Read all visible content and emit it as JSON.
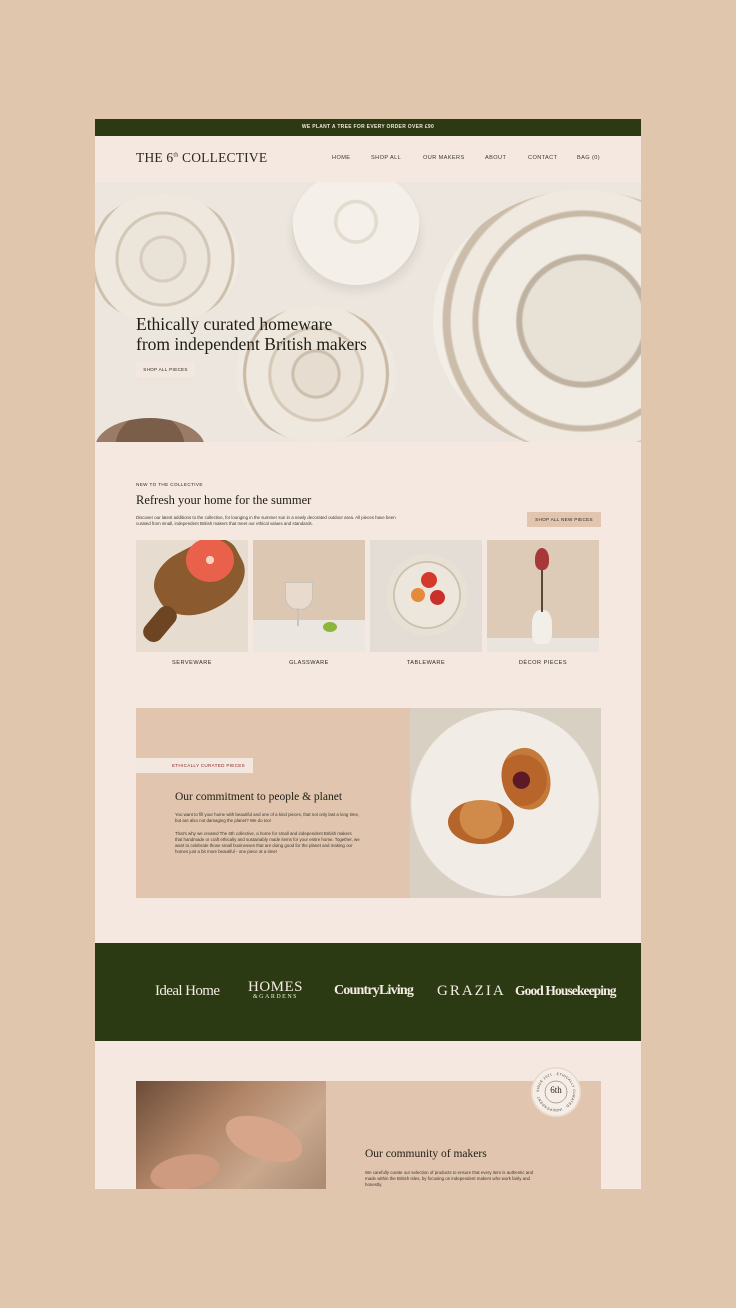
{
  "topbar": {
    "text": "WE PLANT A TREE FOR EVERY ORDER OVER £90"
  },
  "header": {
    "logo_pre": "THE 6",
    "logo_sup": "th",
    "logo_post": " COLLECTIVE",
    "nav": [
      "HOME",
      "SHOP ALL",
      "OUR MAKERS",
      "ABOUT",
      "CONTACT",
      "BAG (0)"
    ]
  },
  "hero": {
    "title_line1": "Ethically curated homeware",
    "title_line2": "from independent British makers",
    "button": "SHOP ALL PIECES"
  },
  "new_section": {
    "eyebrow": "NEW TO THE COLLECTIVE",
    "title": "Refresh your home for the summer",
    "body": "Discover our latest additions to the collective, for lounging in the summer sun in a newly decorated outdoor area. All pieces have been curated from small, independent British makers that meet our ethical values and standards.",
    "button": "SHOP ALL NEW PIECES",
    "categories": [
      "SERVEWARE",
      "GLASSWARE",
      "TABLEWARE",
      "DÉCOR PIECES"
    ]
  },
  "commitment": {
    "tag": "ETHICALLY CURATED PIECES",
    "title": "Our commitment to people & planet",
    "para1": "You want to fill your home with beautiful and one of a kind pieces, that not only last a long time, but are also not damaging the planet? We do too!",
    "para2": "That's why we created The 6th collective, a home for small and independent British makers that handmade or craft ethically and sustainably made items for your entire home. Together, we want to celebrate those small businesses that are doing good for the planet and making our homes just a bit more beautiful - one piece at a time!"
  },
  "press": [
    "Ideal Home",
    "HOMES",
    "&GARDENS",
    "CountryLiving",
    "GRAZIA",
    "Good Housekeeping"
  ],
  "makers": {
    "badge": "6th",
    "badge_ring": "SINCE 2021 · ETHICALLY CURATED · INDEPENDENT",
    "title": "Our community of makers",
    "body": "We carefully curate our selection of products to ensure that every item is authentic and made within the British Isles, by focusing on independent makers who work fairly and honestly."
  },
  "colors": {
    "green": "#2c3a14",
    "tan": "#e1c5ae",
    "cream": "#f5e8e0",
    "outer": "#e1c6ae"
  }
}
